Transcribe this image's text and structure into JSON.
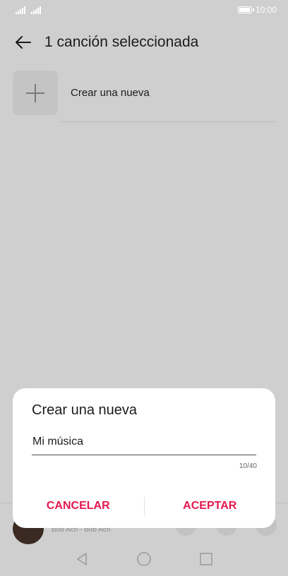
{
  "status_bar": {
    "time": "10:00",
    "battery_level": 1.0
  },
  "header": {
    "title": "1 canción seleccionada",
    "back_icon": "arrow-left-icon"
  },
  "list": {
    "create_new_label": "Crear una nueva",
    "create_icon": "plus-icon"
  },
  "mini_player": {
    "subtitle": "Bob Acri - Bob Acri"
  },
  "dialog": {
    "title": "Crear una nueva",
    "input_value": "Mi música",
    "char_counter": "10/40",
    "cancel_label": "CANCELAR",
    "accept_label": "ACEPTAR",
    "accent_color": "#e4184f"
  },
  "nav_bar": {
    "back_icon": "nav-back-icon",
    "home_icon": "nav-home-icon",
    "recents_icon": "nav-recents-icon"
  }
}
